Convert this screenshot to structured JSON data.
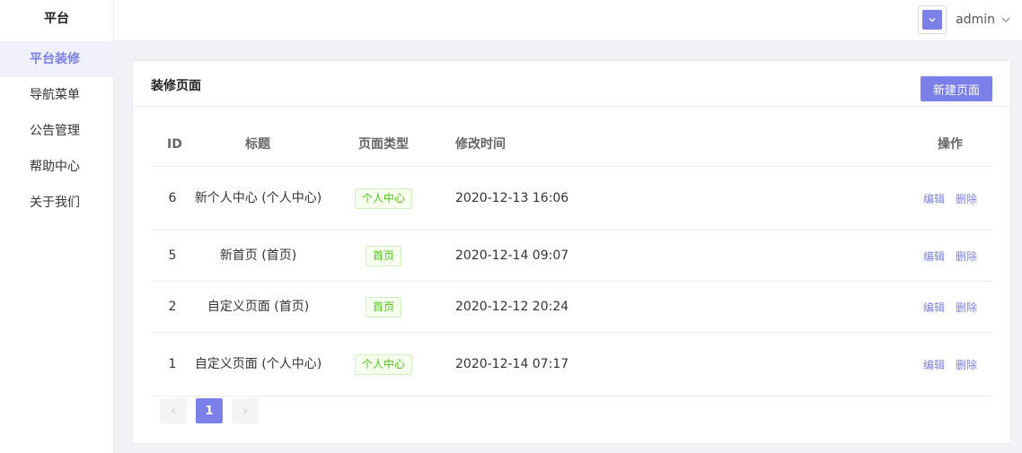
{
  "sidebar": {
    "title": "平台",
    "items": [
      {
        "label": "平台装修",
        "active": true
      },
      {
        "label": "导航菜单",
        "active": false
      },
      {
        "label": "公告管理",
        "active": false
      },
      {
        "label": "帮助中心",
        "active": false
      },
      {
        "label": "关于我们",
        "active": false
      }
    ]
  },
  "header": {
    "username": "admin",
    "avatar_icon": "chevron-down-icon"
  },
  "card": {
    "title": "装修页面",
    "new_button": "新建页面"
  },
  "table": {
    "columns": {
      "id": "ID",
      "title": "标题",
      "type": "页面类型",
      "time": "修改时间",
      "ops": "操作"
    },
    "rows": [
      {
        "id": "6",
        "title": "新个人中心 (个人中心)",
        "type": "个人中心",
        "time": "2020-12-13 16:06",
        "edit": "编辑",
        "delete": "删除"
      },
      {
        "id": "5",
        "title": "新首页 (首页)",
        "type": "首页",
        "time": "2020-12-14 09:07",
        "edit": "编辑",
        "delete": "删除"
      },
      {
        "id": "2",
        "title": "自定义页面 (首页)",
        "type": "首页",
        "time": "2020-12-12 20:24",
        "edit": "编辑",
        "delete": "删除"
      },
      {
        "id": "1",
        "title": "自定义页面 (个人中心)",
        "type": "个人中心",
        "time": "2020-12-14 07:17",
        "edit": "编辑",
        "delete": "删除"
      }
    ]
  },
  "pagination": {
    "prev": "‹",
    "current": "1",
    "next": "›"
  },
  "colors": {
    "accent": "#7b80e8",
    "tag_green": "#52c41a",
    "background": "#f0f2f5"
  }
}
